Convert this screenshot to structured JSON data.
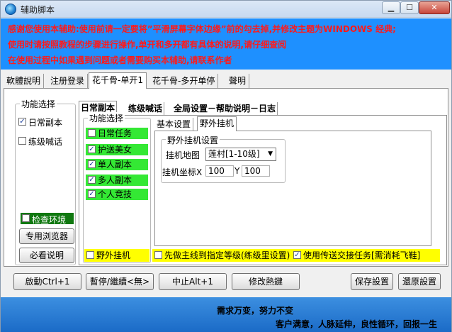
{
  "window": {
    "title": "辅助脚本"
  },
  "notice": {
    "line1": "感谢您使用本辅助:使用前请一定要将”平滑屏幕字体边缘”前的勾去掉,并修改主题为WINDOWS 经典;",
    "line2": "使用时请按照教程的步骤进行操作,单开和多开都有具体的说明,请仔细查阅",
    "line3": "在使用过程中如果遇到问题或者需要购买本辅助,请联系作者"
  },
  "top_tabs": [
    "軟體說明",
    "注册登录",
    "花千骨-单开1",
    "花千骨-多开单停",
    "聲明"
  ],
  "func_select": {
    "title": "功能选择",
    "items": [
      {
        "label": "日常副本",
        "checked": true
      },
      {
        "label": "练级喊话",
        "checked": false
      }
    ],
    "check_env": "检查环境",
    "browser_btn": "专用浏览器",
    "must_read_btn": "必看说明"
  },
  "inner_tabs": [
    "日常副本",
    "练级喊话",
    "全局设置－帮助说明－日志"
  ],
  "daily": {
    "title": "功能选择",
    "items": [
      {
        "label": "日常任务",
        "checked": false
      },
      {
        "label": "护送美女",
        "checked": true
      },
      {
        "label": "单人副本",
        "checked": true
      },
      {
        "label": "多人副本",
        "checked": true
      },
      {
        "label": "个人竞技",
        "checked": true
      }
    ],
    "wild_label": "野外挂机"
  },
  "sub_tabs": [
    "基本设置",
    "野外挂机"
  ],
  "wild": {
    "title": "野外挂机设置",
    "map_label": "挂机地图",
    "map_value": "莲村[1-10级]",
    "coord_label": "挂机坐标X",
    "x_value": "100",
    "y_label": "Y",
    "y_value": "100"
  },
  "options": {
    "main_quest": "先做主线到指定等级(练级里设置)",
    "teleport": "使用传送交接任务[需消耗飞鞋]"
  },
  "buttons": {
    "start": "啟動Ctrl+1",
    "pause": "暫停/繼續<無>",
    "stop": "中止Alt+1",
    "hotkey": "修改熱鍵",
    "save": "保存設置",
    "restore": "還原設置"
  },
  "footer": {
    "line1": "需求万变，努力不变",
    "line2": "客户满意，人脉延伸，良性循环，回报一生"
  }
}
